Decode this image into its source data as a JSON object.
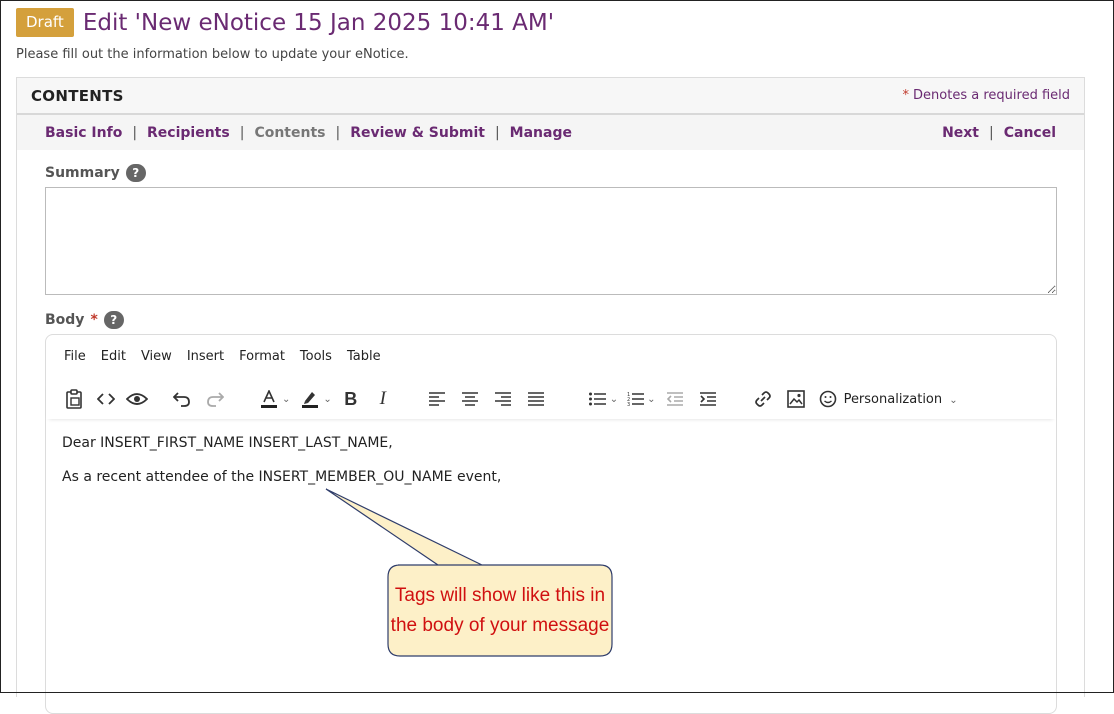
{
  "header": {
    "badge": "Draft",
    "title": "Edit 'New eNotice 15 Jan 2025 10:41 AM'",
    "subtitle": "Please fill out the information below to update your eNotice."
  },
  "panel": {
    "title": "CONTENTS",
    "required_star": "*",
    "required_note": "Denotes a required field"
  },
  "nav": {
    "basic_info": "Basic Info",
    "recipients": "Recipients",
    "contents": "Contents",
    "review_submit": "Review & Submit",
    "manage": "Manage",
    "next": "Next",
    "cancel": "Cancel",
    "separator": "|"
  },
  "summary": {
    "label": "Summary",
    "help": "?",
    "value": ""
  },
  "body": {
    "label": "Body",
    "required_star": "*",
    "help": "?",
    "menu": [
      "File",
      "Edit",
      "View",
      "Insert",
      "Format",
      "Tools",
      "Table"
    ],
    "personalization": "Personalization",
    "lines": [
      "Dear INSERT_FIRST_NAME INSERT_LAST_NAME,",
      "As a recent attendee of the INSERT_MEMBER_OU_NAME event,"
    ]
  },
  "callout": {
    "text": "Tags will show like this in the body of your message",
    "color": "#d01010",
    "fill": "#fdf0c8"
  },
  "colors": {
    "brand": "#6a2a72",
    "badge": "#d4a03c"
  }
}
